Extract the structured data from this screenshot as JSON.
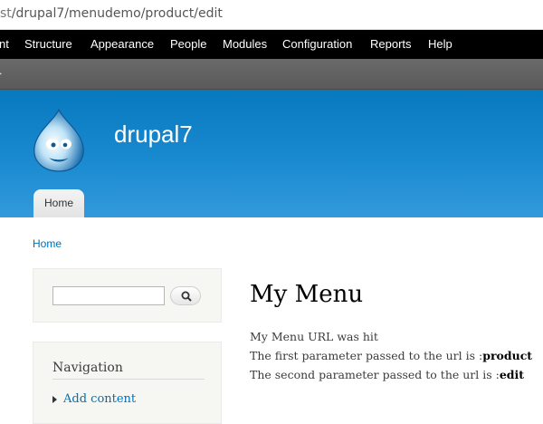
{
  "address_bar": {
    "url_prefix": "st",
    "url_path": "/drupal7/menudemo/product/edit"
  },
  "toolbar": {
    "items": [
      "nt",
      "Structure",
      "Appearance",
      "People",
      "Modules",
      "Configuration",
      "Reports",
      "Help"
    ]
  },
  "header": {
    "site_name": "drupal7",
    "tabs": [
      {
        "label": "Home"
      }
    ]
  },
  "breadcrumb": {
    "items": [
      "Home"
    ]
  },
  "sidebar": {
    "search": {
      "value": "",
      "button_icon": "search-icon"
    },
    "navigation": {
      "title": "Navigation",
      "links": [
        "Add content"
      ]
    }
  },
  "main": {
    "title": "My Menu",
    "line1": "My Menu URL was hit",
    "line2_prefix": "The first parameter passed to the url is :",
    "line2_value": "product",
    "line3_prefix": "The second parameter passed to the url is :",
    "line3_value": "edit"
  },
  "colors": {
    "toolbar_bg": "#000000",
    "shortcut_bg": "#5f5f5f",
    "header_blue": "#0779bf",
    "link_blue": "#0071b3"
  }
}
